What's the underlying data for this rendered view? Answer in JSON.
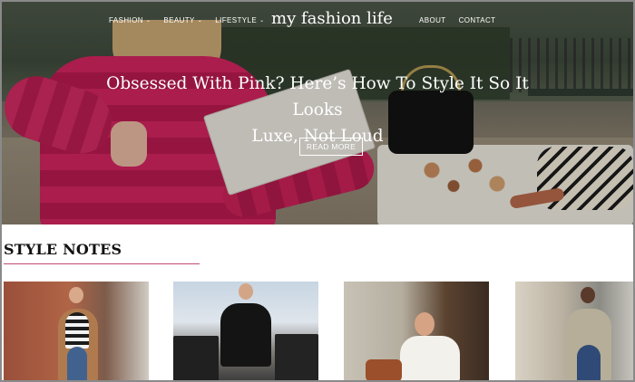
{
  "site": {
    "title": "my fashion life"
  },
  "nav": {
    "left": [
      {
        "label": "FASHION",
        "has_dropdown": true
      },
      {
        "label": "BEAUTY",
        "has_dropdown": true
      },
      {
        "label": "LIFESTYLE",
        "has_dropdown": true
      }
    ],
    "right": [
      {
        "label": "ABOUT"
      },
      {
        "label": "CONTACT"
      }
    ],
    "dropdown_glyph": "⌄"
  },
  "hero": {
    "title_line1": "Obsessed With Pink? Here’s How To Style It So It Looks",
    "title_line2": "Luxe, Not Loud",
    "button_label": "READ MORE"
  },
  "style_notes": {
    "heading": "STYLE NOTES",
    "accent_color": "#c14a74"
  },
  "icons": [
    "chevron-down-icon"
  ]
}
